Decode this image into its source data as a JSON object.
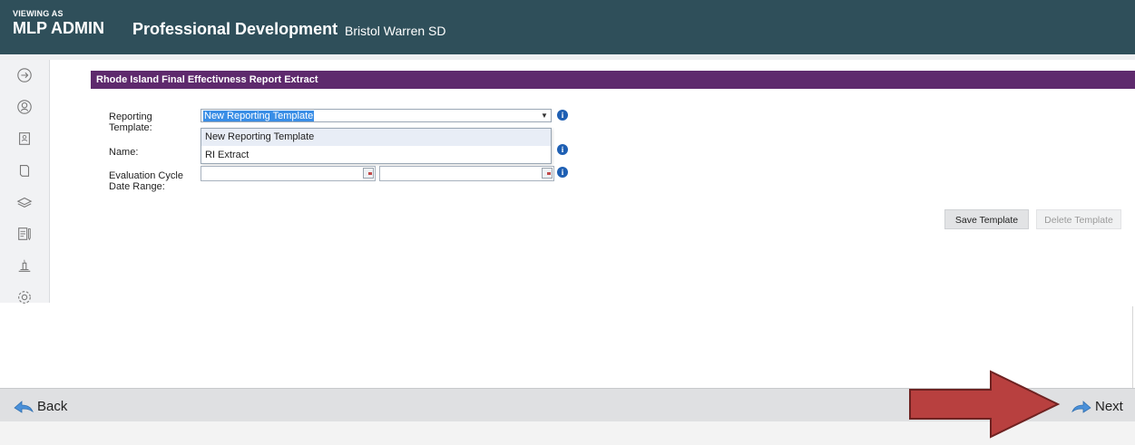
{
  "header": {
    "viewing_label": "VIEWING AS",
    "role": "MLP ADMIN",
    "app_title": "Professional Development",
    "district": "Bristol Warren SD"
  },
  "sidebar": {
    "items": [
      {
        "icon": "arrow-circle-right-icon"
      },
      {
        "icon": "user-circle-icon"
      },
      {
        "icon": "contacts-book-icon"
      },
      {
        "icon": "book-icon"
      },
      {
        "icon": "layers-icon"
      },
      {
        "icon": "notes-icon"
      },
      {
        "icon": "candle-icon"
      },
      {
        "icon": "gear-icon"
      }
    ]
  },
  "panel": {
    "title": "Rhode Island Final Effectivness Report Extract",
    "reporting_template_label": "Reporting Template:",
    "name_label": "Name:",
    "eval_cycle_label": "Evaluation Cycle Date Range:",
    "reporting_template_value": "New Reporting Template",
    "dropdown_options": [
      "New Reporting Template",
      "RI Extract"
    ],
    "info_glyph": "i",
    "save_template": "Save Template",
    "delete_template": "Delete Template"
  },
  "footer": {
    "back_label": "Back",
    "next_label": "Next"
  },
  "colors": {
    "header_bg": "#2f4f5a",
    "panel_header_bg": "#5e2a6d",
    "highlight_arrow": "#b8403f",
    "selection": "#3a8ee6"
  }
}
